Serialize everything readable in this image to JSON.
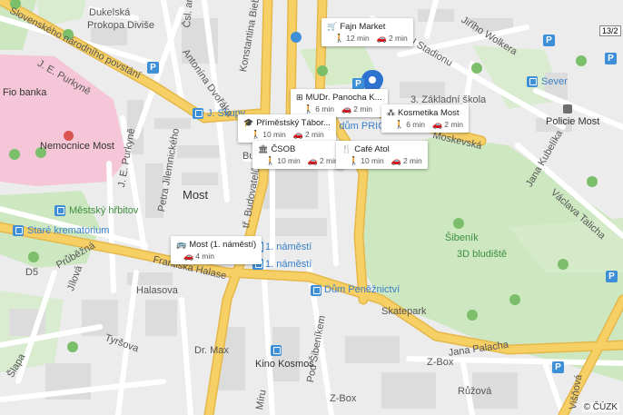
{
  "street_labels": {
    "slovenskeho": "Slovenského národního povstání",
    "dukelska": "Dukelská",
    "prokopa": "Prokopa Diviše",
    "cs_arm": "Čsl. arm",
    "konstantina": "Konstantina Biebla",
    "antonina": "Antonína Dvořáka",
    "jiriho": "Jiřího Wolkera",
    "u_stadionu": "U Stadionu",
    "jepurkyne_top": "J. E. Purkyně",
    "jepurkyne_mid": "J. E. Purkyně",
    "fio": "Fio banka",
    "nemocnice": "Nemocnice Most",
    "petra": "Petra Jilemnického",
    "most": "Most",
    "mestsky": "Městský hřbitov",
    "stare": "Staré krematorium",
    "prubezna": "Průběžná",
    "jilkova": "Jílová",
    "halasova": "Halasova",
    "frantiska": "Františka Halase",
    "tyrsova": "Tyršova",
    "slapa": "Šlapa",
    "d5": "D5",
    "jskupy": "J. Skupy",
    "moskevska": "Moskevská",
    "sever": "Sever",
    "zakladni": "3. Základní škola",
    "policie": "Policie Most",
    "jana_kubelika": "Jana Kubelíka",
    "vaclava": "Václava Talicha",
    "sibenik": "Šibeník",
    "bludiste": "3D bludiště",
    "dum_penez": "Dům Peněžnictví",
    "skatepark": "Skatepark",
    "jana_palacha": "Jana Palacha",
    "zbox1": "Z-Box",
    "zbox2": "Z-Box",
    "ruzova": "Růžová",
    "pod_sibenikem": "Pod Šibeníkem",
    "kino": "Kino Kosmos",
    "drmax": "Dr. Max",
    "jednatel1": "1. náměstí",
    "jednatel2": "1. náměstí",
    "bud": "Bud",
    "prior": "pod dům PRIOR",
    "visnova": "Višňová",
    "budovatel": "tř. Budovatelů",
    "miru": "Míru",
    "road_no": "13/2"
  },
  "cards": {
    "fajn": {
      "name": "Fajn Market",
      "walk": "12 min",
      "car": "2 min"
    },
    "mudr": {
      "name": "MUDr. Panocha K...",
      "walk": "6 min",
      "car": "2 min"
    },
    "kosmetika": {
      "name": "Kosmetika Most",
      "walk": "6 min",
      "car": "2 min"
    },
    "primestsky": {
      "name": "Příměstský Tábor...",
      "walk": "10 min",
      "car": "2 min"
    },
    "csob": {
      "name": "ČSOB",
      "walk": "10 min",
      "car": "2 min"
    },
    "cafe": {
      "name": "Café Atol",
      "walk": "10 min",
      "car": "2 min"
    },
    "most_stop": {
      "name": "Most (1. náměstí)",
      "car": "4 min"
    }
  },
  "copyright": "© ČÚZK",
  "parking_letter": "P",
  "colors": {
    "road_yellow": "#f6cf65",
    "park_green": "#cde7c1",
    "hospital_pink": "#f5c6d8",
    "map_bg": "#ececec",
    "pin_blue": "#2e73d0",
    "bus_blue": "#3d8fd7"
  }
}
